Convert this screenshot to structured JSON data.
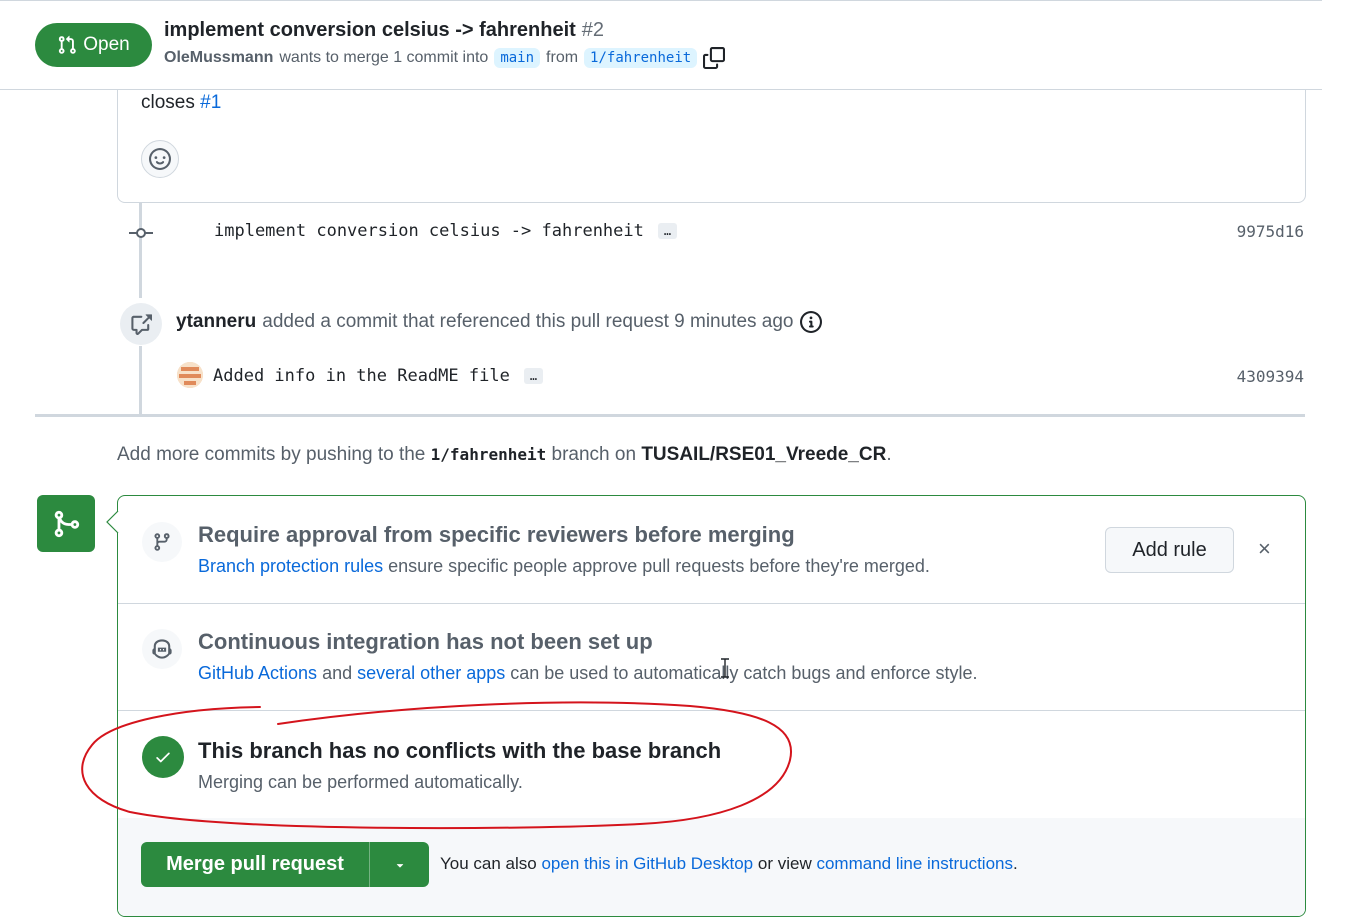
{
  "header": {
    "status_label": "Open",
    "title": "implement conversion celsius -> fahrenheit",
    "number": "#2",
    "author": "OleMussmann",
    "merge_text": "wants to merge 1 commit into",
    "base_branch": "main",
    "from_text": "from",
    "head_branch": "1/fahrenheit",
    "icons": [
      "git-pull-request-icon",
      "copy-icon"
    ]
  },
  "comment": {
    "closes_text": "closes",
    "closes_ref": "#1",
    "icons": [
      "smiley-icon"
    ]
  },
  "timeline": {
    "commit1": {
      "message": "implement conversion celsius -> fahrenheit",
      "ellipsis": "…",
      "sha": "9975d16"
    },
    "reference": {
      "user": "ytanneru",
      "text": "added a commit that referenced this pull request 9 minutes ago"
    },
    "commit2": {
      "message": "Added info in the ReadME file",
      "ellipsis": "…",
      "sha": "4309394"
    }
  },
  "hint": {
    "prefix": "Add more commits by pushing to the",
    "branch": "1/fahrenheit",
    "middle": "branch on",
    "repo": "TUSAIL/RSE01_Vreede_CR",
    "suffix": "."
  },
  "merge_box": {
    "approval": {
      "title": "Require approval from specific reviewers before merging",
      "link": "Branch protection rules",
      "desc": "ensure specific people approve pull requests before they're merged.",
      "button": "Add rule",
      "close": "×"
    },
    "ci": {
      "title": "Continuous integration has not been set up",
      "link1": "GitHub Actions",
      "and": "and",
      "link2": "several other apps",
      "desc": "can be used to automatically catch bugs and enforce style."
    },
    "conflicts": {
      "title": "This branch has no conflicts with the base branch",
      "desc": "Merging can be performed automatically."
    },
    "footer": {
      "merge_button": "Merge pull request",
      "also_text": "You can also",
      "desktop_link": "open this in GitHub Desktop",
      "or_text": "or view",
      "cli_link": "command line instructions",
      "period": "."
    }
  },
  "colors": {
    "green": "#2c8a3f",
    "link": "#0969da",
    "annotation": "#d4141c"
  }
}
